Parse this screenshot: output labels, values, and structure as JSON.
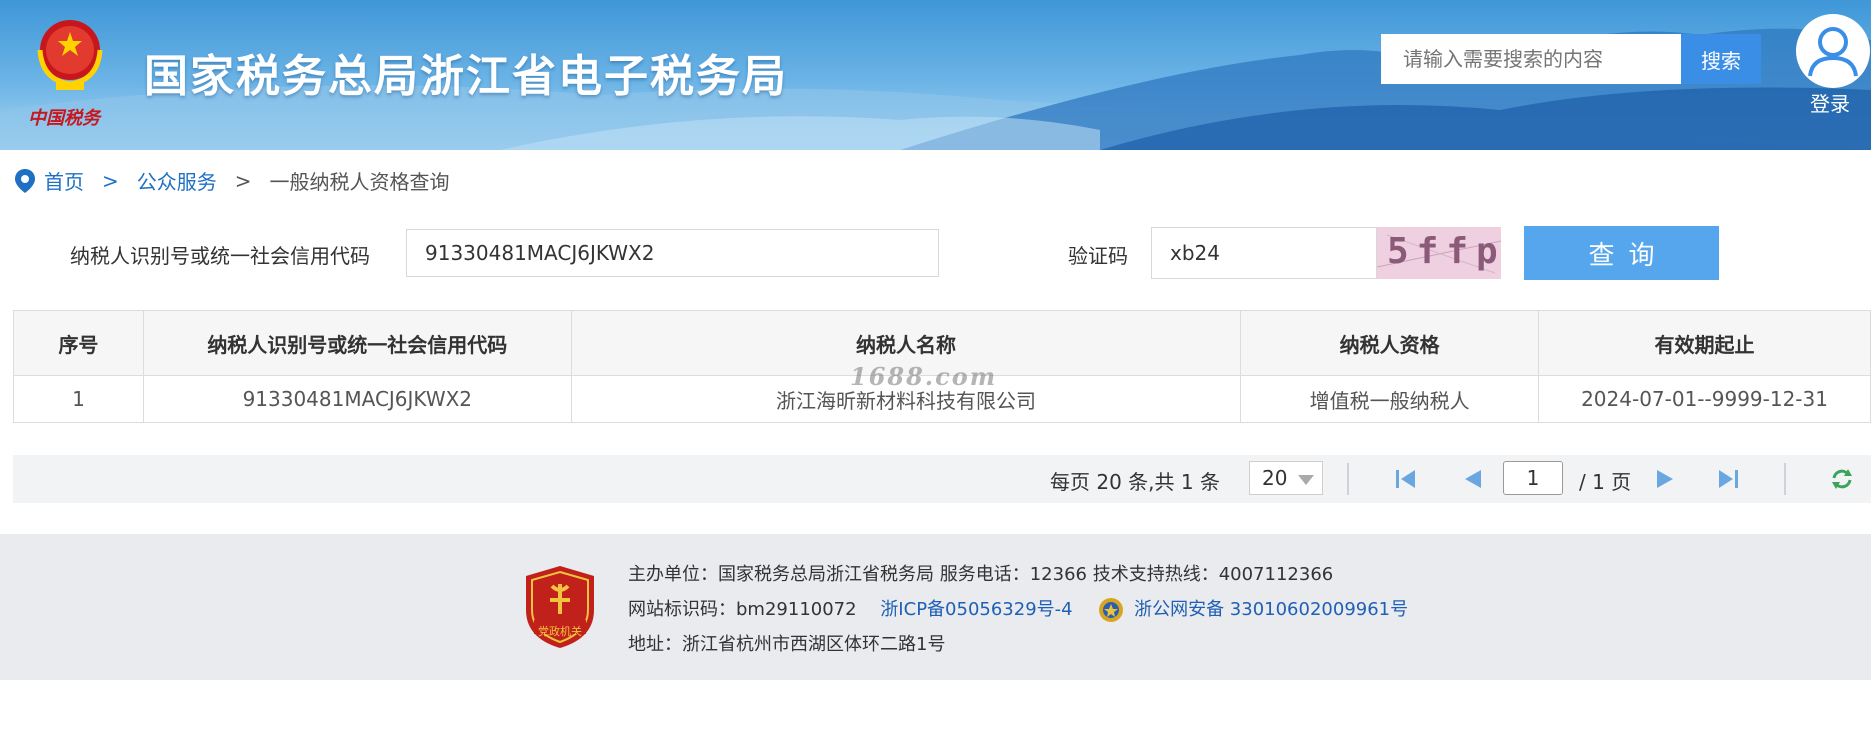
{
  "header": {
    "site_title": "国家税务总局浙江省电子税务局",
    "emblem_caption": "中国税务",
    "search_placeholder": "请输入需要搜索的内容",
    "search_button": "搜索",
    "login_label": "登录"
  },
  "breadcrumb": {
    "home": "首页",
    "sep": ">",
    "public_services": "公众服务",
    "current": "一般纳税人资格查询"
  },
  "form": {
    "taxpayer_id_label": "纳税人识别号或统一社会信用代码",
    "taxpayer_id_value": "91330481MACJ6JKWX2",
    "captcha_label": "验证码",
    "captcha_value": "xb24",
    "captcha_image_text": "5ffp",
    "query_button": "查询"
  },
  "table": {
    "headers": [
      "序号",
      "纳税人识别号或统一社会信用代码",
      "纳税人名称",
      "纳税人资格",
      "有效期起止"
    ],
    "rows": [
      [
        "1",
        "91330481MACJ6JKWX2",
        "浙江海昕新材料科技有限公司",
        "增值税一般纳税人",
        "2024-07-01--9999-12-31"
      ]
    ],
    "watermark": "1688.com"
  },
  "pager": {
    "summary": "每页 20 条,共 1 条",
    "page_size": "20",
    "current_page": "1",
    "total_pages": "/ 1 页"
  },
  "footer": {
    "badge_text": "党政机关",
    "line1": "主办单位：国家税务总局浙江省税务局     服务电话：12366     技术支持热线：4007112366",
    "site_id": "网站标识码：bm29110072",
    "icp": "浙ICP备05056329号-4",
    "police": "浙公网安备 33010602009961号",
    "address": "地址：浙江省杭州市西湖区体环二路1号"
  },
  "colors": {
    "header_blue": "#3f97d8",
    "search_button": "#3a8ee6",
    "query_button": "#55a6ec",
    "link": "#1f6fc5"
  }
}
